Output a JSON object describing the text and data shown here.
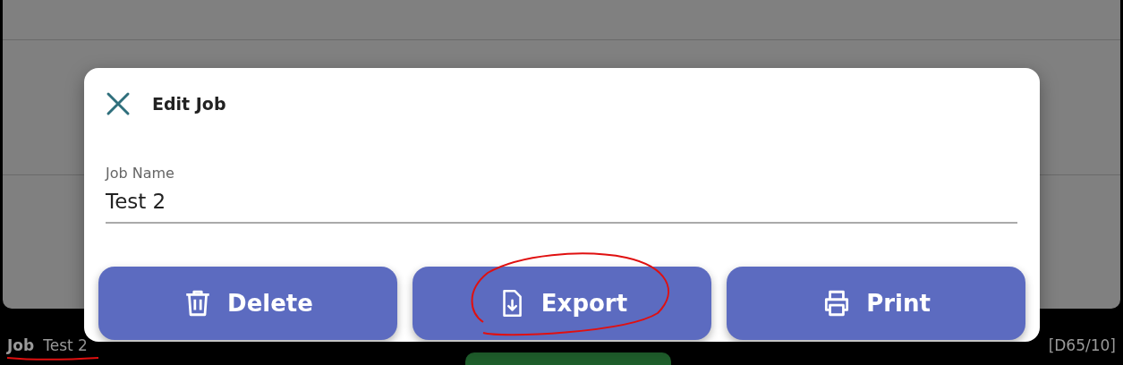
{
  "dialog": {
    "title": "Edit Job",
    "field": {
      "label": "Job Name",
      "value": "Test 2"
    },
    "buttons": [
      {
        "kind": "delete",
        "label": "Delete",
        "circled": false
      },
      {
        "kind": "export",
        "label": "Export",
        "circled": true
      },
      {
        "kind": "print",
        "label": "Print",
        "circled": false
      }
    ]
  },
  "status_bar": {
    "label": "Job",
    "value": "Test 2",
    "underlined": true,
    "right_text": "[D65/10]"
  }
}
